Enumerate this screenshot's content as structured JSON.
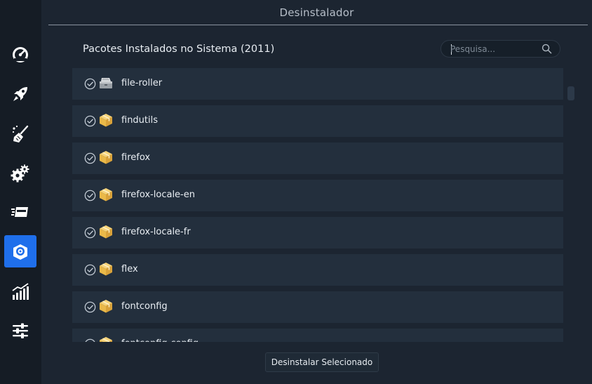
{
  "window": {
    "title": "Desinstalador"
  },
  "sidebar": {
    "items": [
      {
        "icon": "speedometer-icon",
        "active": false
      },
      {
        "icon": "rocket-icon",
        "active": false
      },
      {
        "icon": "broom-cleaner-icon",
        "active": false
      },
      {
        "icon": "gears-icon",
        "active": false
      },
      {
        "icon": "fast-drive-icon",
        "active": false
      },
      {
        "icon": "uninstaller-package-icon",
        "active": true
      },
      {
        "icon": "resources-chart-icon",
        "active": false
      },
      {
        "icon": "settings-sliders-icon",
        "active": false
      }
    ]
  },
  "main": {
    "heading": "Pacotes Instalados no Sistema (2011)",
    "search": {
      "placeholder": "Pesquisa...",
      "value": ""
    },
    "packages": [
      {
        "name": "file-roller",
        "icon": "archive-manager-icon",
        "checked": true
      },
      {
        "name": "findutils",
        "icon": "package-box-icon",
        "checked": true
      },
      {
        "name": "firefox",
        "icon": "package-box-icon",
        "checked": true
      },
      {
        "name": "firefox-locale-en",
        "icon": "package-box-icon",
        "checked": true
      },
      {
        "name": "firefox-locale-fr",
        "icon": "package-box-icon",
        "checked": true
      },
      {
        "name": "flex",
        "icon": "package-box-icon",
        "checked": true
      },
      {
        "name": "fontconfig",
        "icon": "package-box-icon",
        "checked": true
      },
      {
        "name": "fontconfig-config",
        "icon": "package-box-icon",
        "checked": true
      }
    ],
    "uninstall_label": "Desinstalar Selecionado"
  },
  "colors": {
    "sidebar_bg": "#151c25",
    "main_bg": "#1c2531",
    "row_bg": "#232f3d",
    "accent": "#1f6feb",
    "package_icon": "#f2c35b"
  }
}
